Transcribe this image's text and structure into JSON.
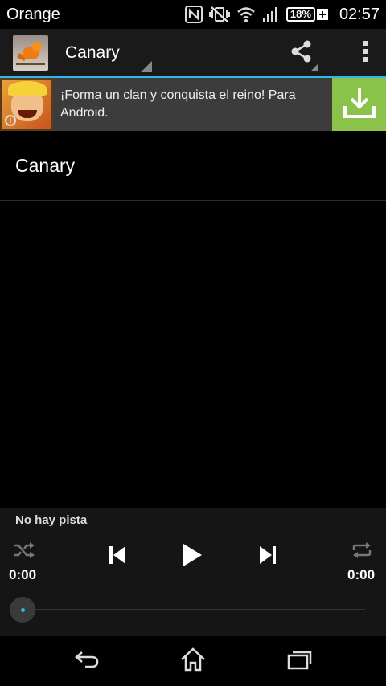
{
  "status_bar": {
    "carrier": "Orange",
    "battery_percent": "18%",
    "time": "02:57",
    "icons": [
      "nfc-icon",
      "vibrate-off-icon",
      "wifi-icon",
      "signal-icon",
      "battery-icon",
      "charging-icon"
    ]
  },
  "action_bar": {
    "app_icon": "canary-bird-icon",
    "title": "Canary",
    "share_icon": "share-icon",
    "overflow_icon": "overflow-menu-icon"
  },
  "ad": {
    "text": "¡Forma un clan y conquista el reino! Para Android.",
    "info_glyph": "i",
    "download_icon": "download-icon",
    "accent_color": "#8bc34a"
  },
  "list": {
    "items": [
      {
        "label": "Canary"
      }
    ]
  },
  "player": {
    "now_playing": "No hay pista",
    "elapsed": "0:00",
    "duration": "0:00",
    "progress": 0,
    "icons": [
      "shuffle-icon",
      "previous-icon",
      "play-icon",
      "next-icon",
      "repeat-icon"
    ],
    "accent_color": "#33b5e5"
  },
  "nav_bar": {
    "icons": [
      "back-icon",
      "home-icon",
      "recent-apps-icon"
    ]
  }
}
